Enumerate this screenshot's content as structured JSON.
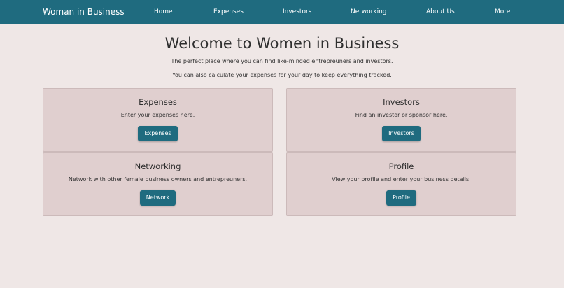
{
  "navbar": {
    "brand": "Woman in Business",
    "items": [
      "Home",
      "Expenses",
      "Investors",
      "Networking",
      "About Us",
      "More"
    ]
  },
  "hero": {
    "title": "Welcome to Women in Business",
    "line1": "The perfect place where you can find like-minded entrepreuners and investors.",
    "line2": "You can also calculate your expenses for your day to keep everything tracked."
  },
  "cards": [
    {
      "title": "Expenses",
      "text": "Enter your expenses here.",
      "button": "Expenses"
    },
    {
      "title": "Investors",
      "text": "Find an investor or sponsor here.",
      "button": "Investors"
    },
    {
      "title": "Networking",
      "text": "Network with other female business owners and entrepreuners.",
      "button": "Network"
    },
    {
      "title": "Profile",
      "text": "View your profile and enter your business details.",
      "button": "Profile"
    }
  ],
  "colors": {
    "navbar": "#1f6b7f",
    "background": "#efe7e6",
    "card": "#e0cfcf",
    "button": "#1f6b7f"
  }
}
